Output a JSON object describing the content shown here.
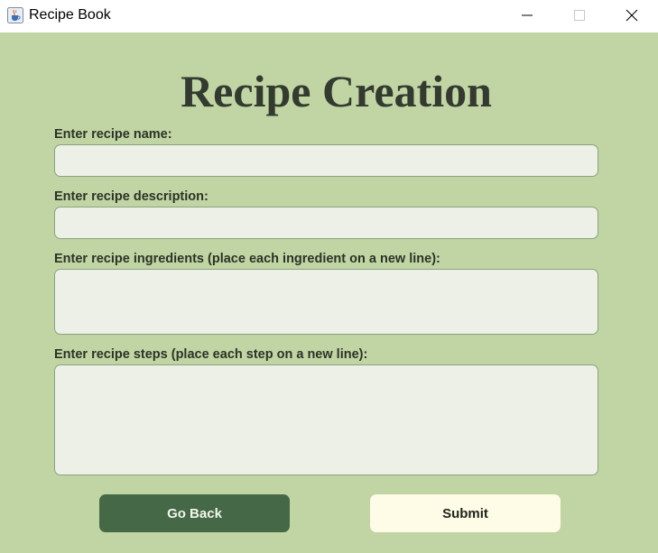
{
  "window": {
    "title": "Recipe Book",
    "app_icon": "java-cup-icon",
    "controls": [
      "minimize-icon",
      "maximize-icon",
      "close-icon"
    ]
  },
  "form": {
    "heading": "Recipe Creation",
    "name_label": "Enter recipe name:",
    "name_value": "",
    "description_label": "Enter recipe description:",
    "description_value": "",
    "ingredients_label": "Enter recipe ingredients (place each ingredient on a new line):",
    "ingredients_value": "",
    "steps_label": "Enter recipe steps (place each step on a new line):",
    "steps_value": ""
  },
  "buttons": {
    "back_label": "Go Back",
    "submit_label": "Submit"
  },
  "colors": {
    "background": "#c1d4a3",
    "field_background": "#edf0e7",
    "field_border": "#8aa37e",
    "back_button": "#456846",
    "submit_button": "#fefbe6",
    "heading_text": "#333a2f"
  }
}
